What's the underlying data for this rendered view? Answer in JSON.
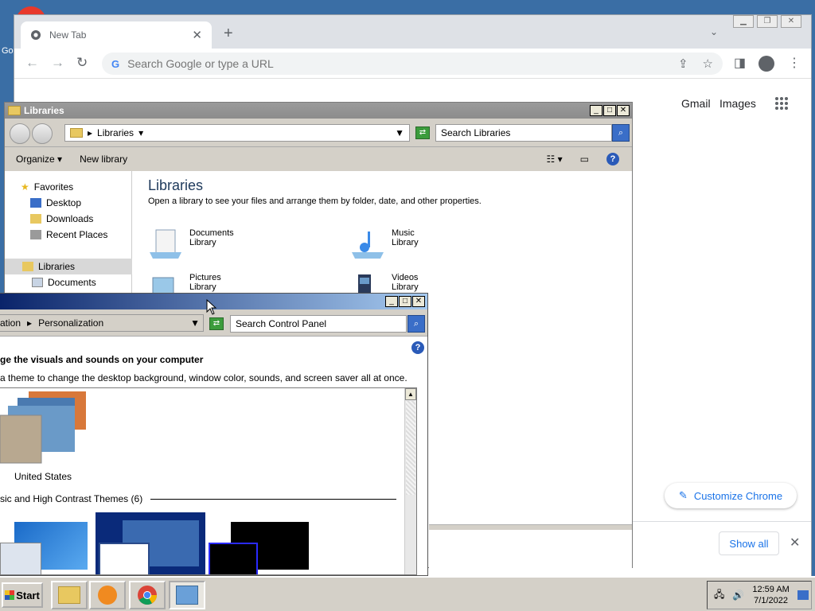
{
  "desktop": {
    "icon_label": "Go"
  },
  "chrome": {
    "tab_title": "New Tab",
    "omnibox_placeholder": "Search Google or type a URL",
    "links": {
      "gmail": "Gmail",
      "images": "Images"
    },
    "customize_label": "Customize Chrome",
    "show_all_label": "Show all"
  },
  "libraries": {
    "window_title": "Libraries",
    "address_path": "Libraries",
    "search_placeholder": "Search Libraries",
    "toolbar": {
      "organize": "Organize",
      "new_library": "New library"
    },
    "nav": {
      "favorites": "Favorites",
      "desktop": "Desktop",
      "downloads": "Downloads",
      "recent_places": "Recent Places",
      "libraries": "Libraries",
      "documents": "Documents"
    },
    "heading": "Libraries",
    "subtitle": "Open a library to see your files and arrange them by folder, date, and other properties.",
    "items": [
      {
        "name": "Documents",
        "type": "Library"
      },
      {
        "name": "Music",
        "type": "Library"
      },
      {
        "name": "Pictures",
        "type": "Library"
      },
      {
        "name": "Videos",
        "type": "Library"
      }
    ]
  },
  "personalization": {
    "address_prefix": "ation",
    "address_current": "Personalization",
    "search_placeholder": "Search Control Panel",
    "heading": "ge the visuals and sounds on your computer",
    "description": "a theme to change the desktop background, window color, sounds, and screen saver all at once.",
    "theme_name": "United States",
    "section_label": "sic and High Contrast Themes (6)"
  },
  "taskbar": {
    "start_label": "Start",
    "clock_time": "12:59 AM",
    "clock_date": "7/1/2022"
  }
}
